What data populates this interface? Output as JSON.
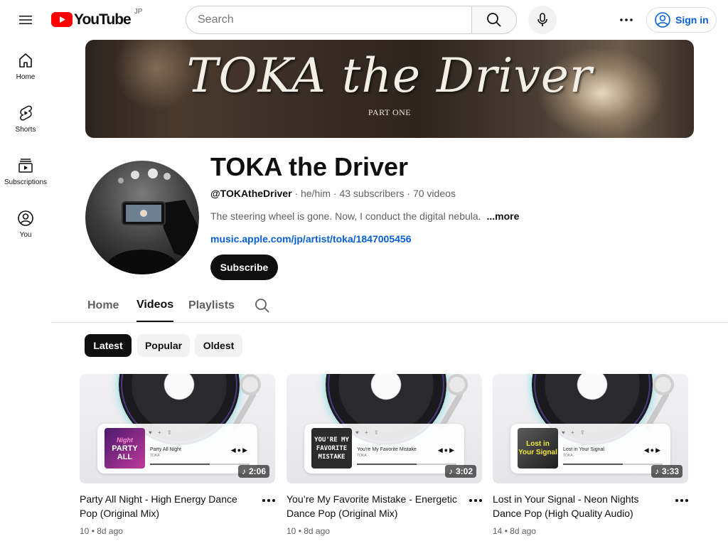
{
  "header": {
    "logo_text": "YouTube",
    "logo_region": "JP",
    "search_placeholder": "Search",
    "sign_in_label": "Sign in"
  },
  "rail": {
    "items": [
      {
        "label": "Home",
        "icon": "home-icon"
      },
      {
        "label": "Shorts",
        "icon": "shorts-icon"
      },
      {
        "label": "Subscriptions",
        "icon": "subscriptions-icon"
      },
      {
        "label": "You",
        "icon": "account-icon"
      }
    ]
  },
  "banner": {
    "title": "TOKA the Driver",
    "subtitle": "PART ONE"
  },
  "channel": {
    "name": "TOKA the Driver",
    "handle": "@TOKAtheDriver",
    "pronouns": "he/him",
    "subscribers": "43 subscribers",
    "videos": "70 videos",
    "description": "The steering wheel is gone. Now, I conduct the digital nebula.",
    "more_label": "...more",
    "link": "music.apple.com/jp/artist/toka/1847005456",
    "subscribe_label": "Subscribe"
  },
  "tabs": [
    {
      "label": "Home",
      "active": false
    },
    {
      "label": "Videos",
      "active": true
    },
    {
      "label": "Playlists",
      "active": false
    }
  ],
  "chips": [
    {
      "label": "Latest",
      "active": true
    },
    {
      "label": "Popular",
      "active": false
    },
    {
      "label": "Oldest",
      "active": false
    }
  ],
  "videos": [
    {
      "title": "Party All Night - High Energy Dance Pop (Original Mix)",
      "duration": "2:06",
      "views": "10",
      "age": "8d ago",
      "cover_text": "PARTY ALL",
      "cover_script": "Night",
      "track_title": "Party All Night",
      "track_artist": "TOKA"
    },
    {
      "title": "You’re My Favorite Mistake - Energetic Dance Pop (Original Mix)",
      "duration": "3:02",
      "views": "10",
      "age": "8d ago",
      "cover_text": "YOU'RE MY FAVORITE MISTAKE",
      "track_title": "You're My Favorite Mistake",
      "track_artist": "TOKA"
    },
    {
      "title": "Lost in Your Signal - Neon Nights Dance Pop (High Quality Audio)",
      "duration": "3:33",
      "views": "14",
      "age": "8d ago",
      "cover_text": "Lost in Your Signal",
      "track_title": "Lost in Your Signal",
      "track_artist": "TOKA"
    }
  ],
  "colors": {
    "brand_red": "#ff0000",
    "link_blue": "#065fd4",
    "text_primary": "#0f0f0f",
    "text_secondary": "#606060"
  }
}
